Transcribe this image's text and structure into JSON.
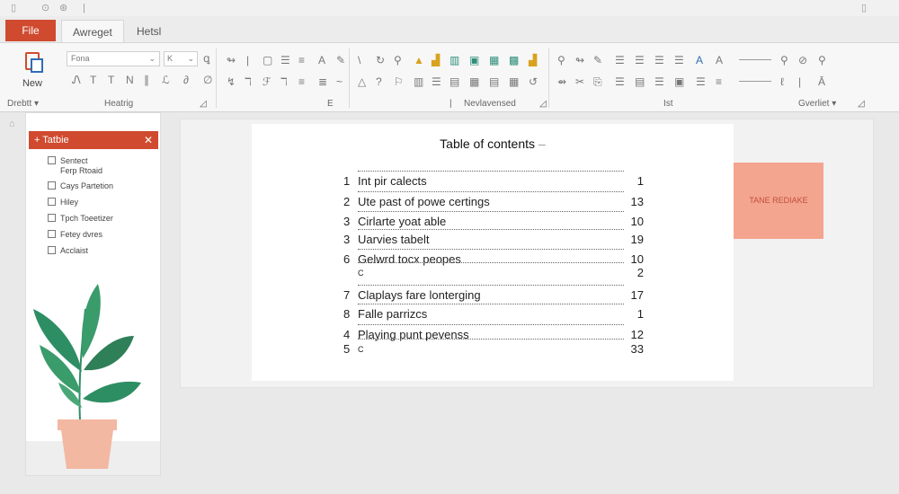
{
  "titlebar": {
    "icons": [
      "doc-icon",
      "undo-icon",
      "redo-icon",
      "separator-icon"
    ]
  },
  "tabs": {
    "file_label": "File",
    "items": [
      {
        "label": "Awreget",
        "active": true
      },
      {
        "label": "Hetsl",
        "active": false
      }
    ]
  },
  "ribbon": {
    "new_label": "New",
    "font_name": "Fona",
    "font_size": "K",
    "groups": {
      "clipboard": "Drebtt",
      "headings": "Heatrig",
      "paragraph": "E",
      "review": "Nevlavensed",
      "styles": "Ist",
      "overflow": "Gverliet"
    }
  },
  "nav_pane": {
    "header": "Tatbie",
    "items": [
      {
        "label": "Sentect",
        "sublabel": "Ferp Rtoaid"
      },
      {
        "label": "Cays Partetion",
        "sublabel": ""
      },
      {
        "label": "Hiley",
        "sublabel": ""
      },
      {
        "label": "Tpch Toeetizer",
        "sublabel": ""
      },
      {
        "label": "Fetey dvres",
        "sublabel": ""
      },
      {
        "label": "Acclaist",
        "sublabel": ""
      }
    ]
  },
  "document": {
    "title": "Table of contents",
    "entries": [
      {
        "num": "1",
        "title": "Int pir calects",
        "page": "1"
      },
      {
        "num": "2",
        "title": "Ute past of powe certings",
        "page": "13"
      },
      {
        "num": "3",
        "title": "Cirlarte yoat able",
        "page": "10"
      },
      {
        "num": "3",
        "title": "Uarvies tabelt",
        "page": "19"
      },
      {
        "num": "6",
        "title": "Gelwrd tocx peopes",
        "page": "10"
      },
      {
        "num": "",
        "title": "C",
        "page": "2"
      },
      {
        "num": "7",
        "title": "Claplays fare lonterging",
        "page": "17"
      },
      {
        "num": "8",
        "title": "Falle parrizcs",
        "page": "1"
      },
      {
        "num": "4",
        "title": "Playing punt pevenss",
        "page": "12"
      },
      {
        "num": "5",
        "title": "C",
        "page": "33"
      }
    ]
  },
  "side_panel": {
    "label": "TANE REDIAKE"
  },
  "colors": {
    "accent": "#d04a2f",
    "side_box": "#f4a58f",
    "plant_leaf": "#2e8e63",
    "pot": "#f3b8a2"
  }
}
